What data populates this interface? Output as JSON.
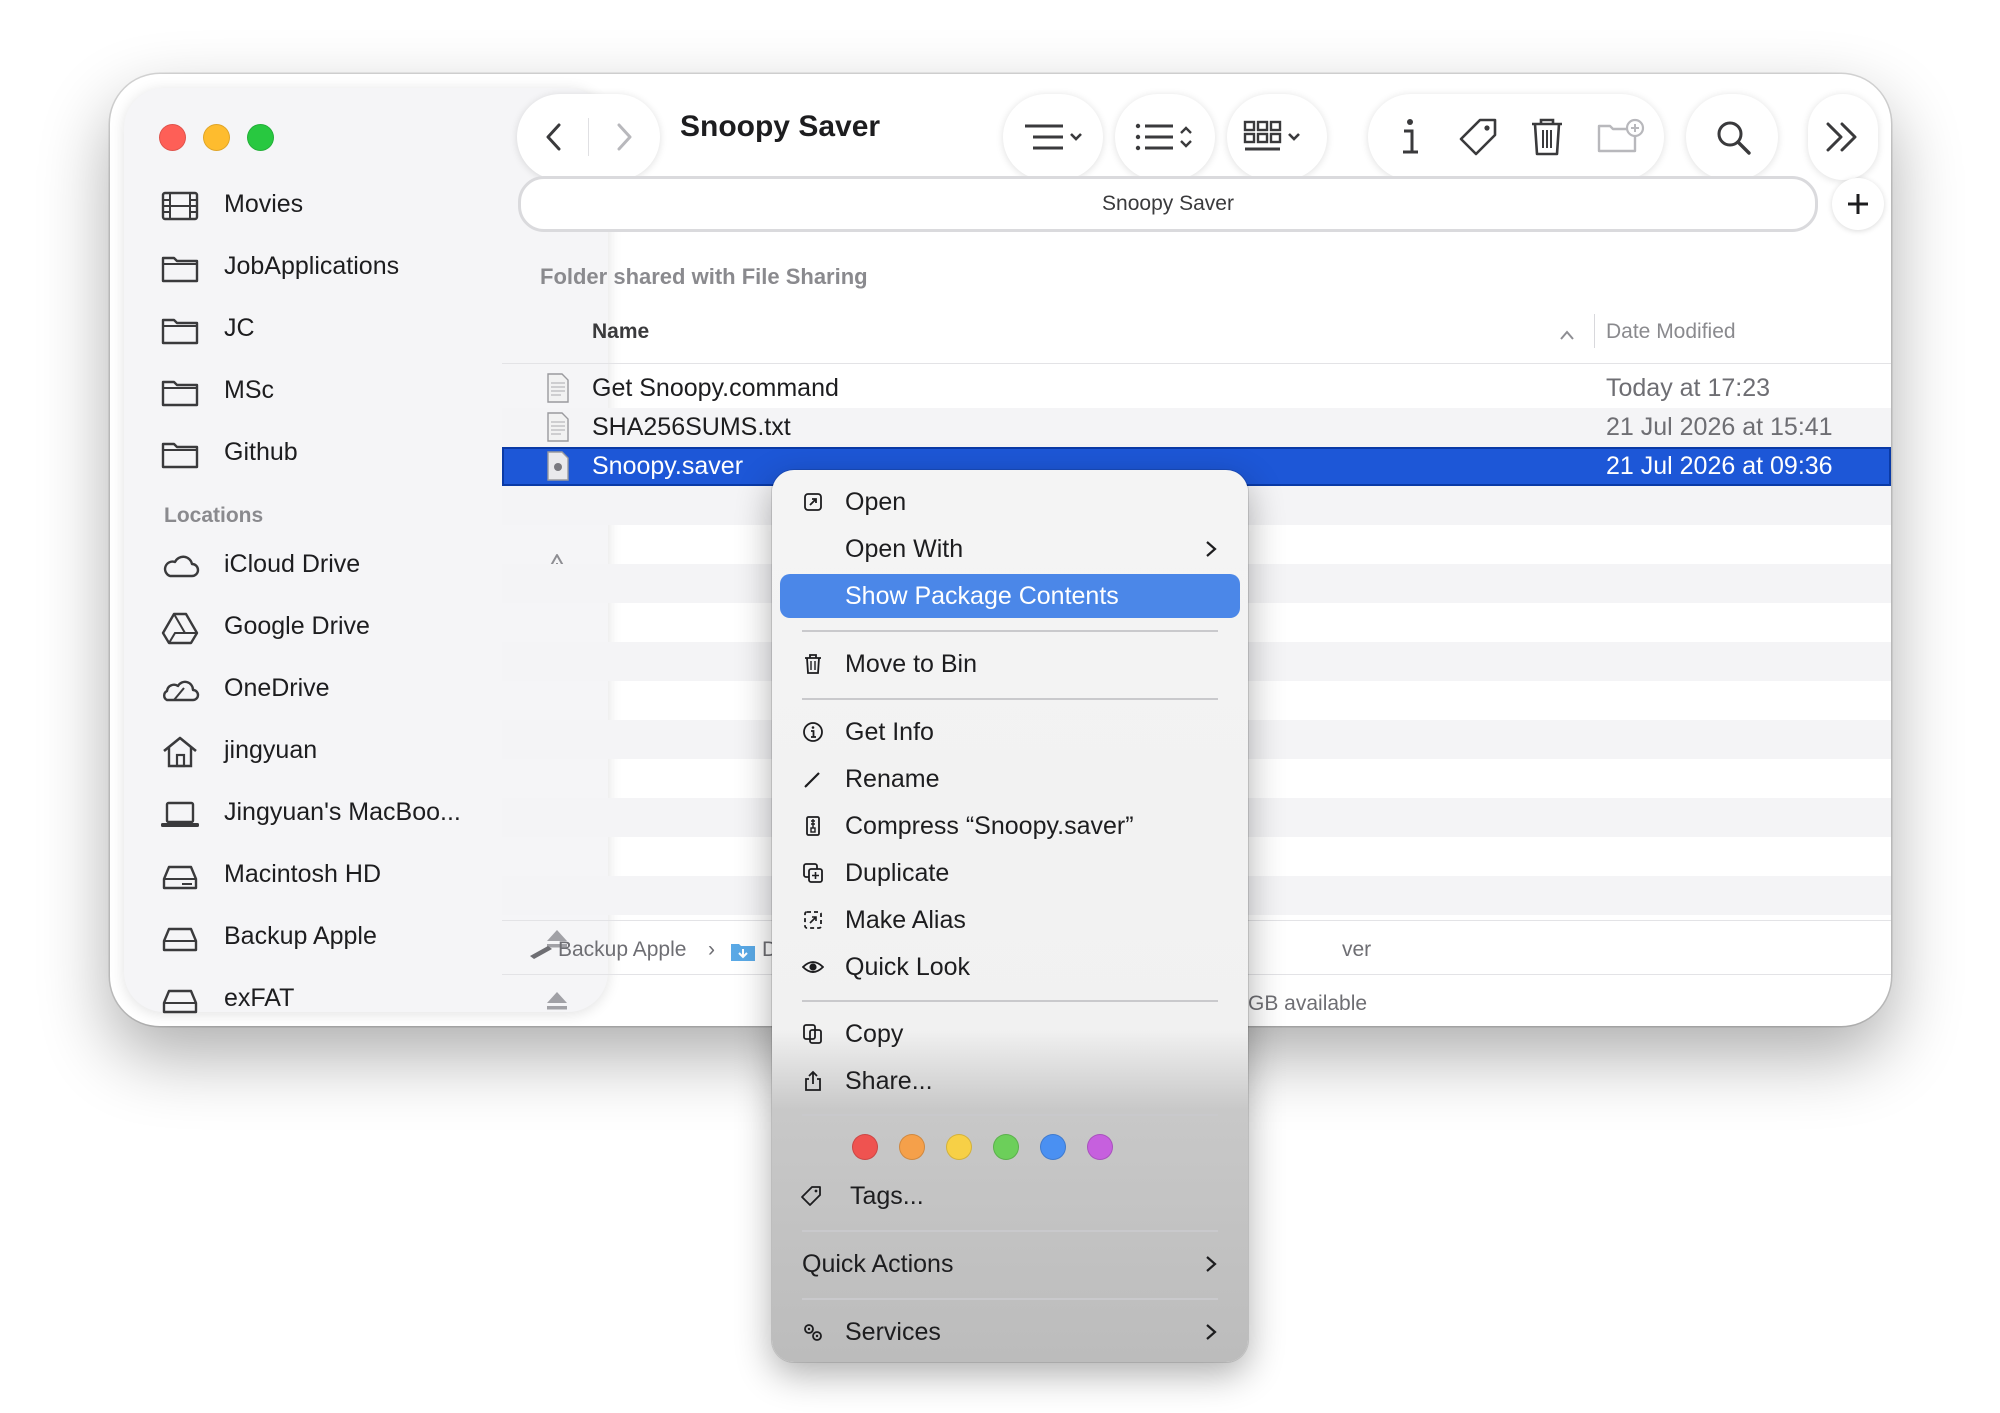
{
  "window": {
    "title": "Snoopy Saver"
  },
  "pathbar": {
    "label": "Snoopy Saver"
  },
  "sidebar": {
    "items": [
      {
        "label": "Movies",
        "icon": "film-icon"
      },
      {
        "label": "JobApplications",
        "icon": "folder-icon"
      },
      {
        "label": "JC",
        "icon": "folder-icon"
      },
      {
        "label": "MSc",
        "icon": "folder-icon"
      },
      {
        "label": "Github",
        "icon": "folder-icon"
      }
    ],
    "locations_title": "Locations",
    "locations": [
      {
        "label": "iCloud Drive",
        "icon": "cloud-icon",
        "trailing": "warning-icon"
      },
      {
        "label": "Google Drive",
        "icon": "google-drive-icon"
      },
      {
        "label": "OneDrive",
        "icon": "onedrive-icon"
      },
      {
        "label": "jingyuan",
        "icon": "home-icon"
      },
      {
        "label": "Jingyuan's MacBoo...",
        "icon": "laptop-icon"
      },
      {
        "label": "Macintosh HD",
        "icon": "disk-icon"
      },
      {
        "label": "Backup Apple",
        "icon": "disk-icon",
        "trailing": "eject-icon"
      },
      {
        "label": "exFAT",
        "icon": "disk-icon",
        "trailing": "eject-icon"
      }
    ]
  },
  "content": {
    "shared_label": "Folder shared with File Sharing",
    "columns": {
      "name": "Name",
      "date": "Date Modified"
    },
    "files": [
      {
        "name": "Get Snoopy.command",
        "date": "Today at 17:23"
      },
      {
        "name": "SHA256SUMS.txt",
        "date": "21 Jul 2026 at 15:41"
      },
      {
        "name": "Snoopy.saver",
        "date": "21 Jul 2026 at 09:36",
        "selected": true
      }
    ]
  },
  "status": {
    "crumb_1": "Backup Apple",
    "crumb_sep": "›",
    "crumb_2_partial": "D",
    "crumb_tail_partial": "ver",
    "available_partial": "GB available"
  },
  "context_menu": {
    "open": "Open",
    "open_with": "Open With",
    "show_package_contents": "Show Package Contents",
    "move_to_bin": "Move to Bin",
    "get_info": "Get Info",
    "rename": "Rename",
    "compress": "Compress “Snoopy.saver”",
    "duplicate": "Duplicate",
    "make_alias": "Make Alias",
    "quick_look": "Quick Look",
    "copy": "Copy",
    "share": "Share...",
    "tags": "Tags...",
    "quick_actions": "Quick Actions",
    "services": "Services",
    "tag_colors": [
      "#ef5350",
      "#f5a04a",
      "#f7d046",
      "#6ccf5a",
      "#4a90f2",
      "#c660de"
    ]
  },
  "colors": {
    "selection": "#1d57d7",
    "menu_highlight": "#4b87e8",
    "close": "#fe5f57",
    "minimize": "#febc2e",
    "zoom": "#28c840"
  }
}
